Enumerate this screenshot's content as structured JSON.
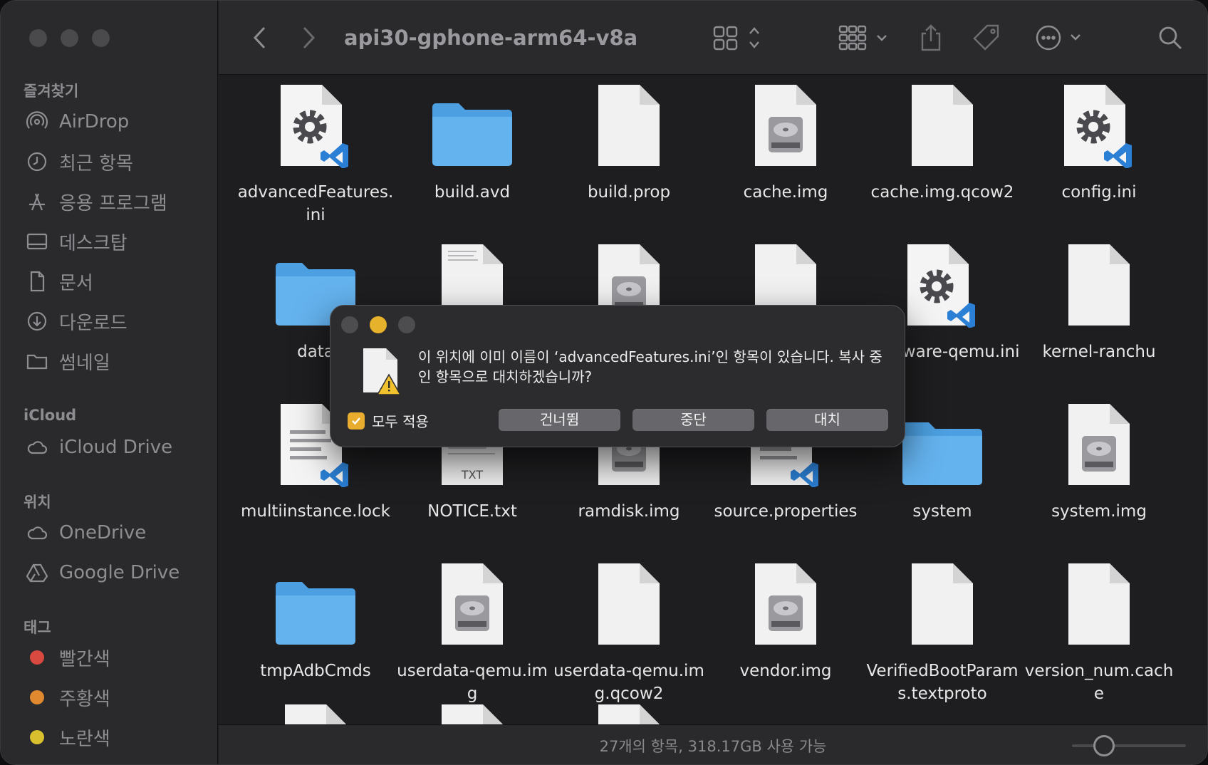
{
  "window": {
    "title": "api30-gphone-arm64-v8a"
  },
  "sidebar": {
    "favorites_header": "즐겨찾기",
    "favorites": [
      {
        "label": "AirDrop",
        "icon": "airdrop-icon"
      },
      {
        "label": "최근 항목",
        "icon": "clock-icon"
      },
      {
        "label": "응용 프로그램",
        "icon": "applications-icon"
      },
      {
        "label": "데스크탑",
        "icon": "desktop-icon"
      },
      {
        "label": "문서",
        "icon": "document-icon"
      },
      {
        "label": "다운로드",
        "icon": "download-icon"
      },
      {
        "label": "썸네일",
        "icon": "folder-icon"
      }
    ],
    "icloud_header": "iCloud",
    "icloud": [
      {
        "label": "iCloud Drive",
        "icon": "cloud-icon"
      }
    ],
    "locations_header": "위치",
    "locations": [
      {
        "label": "OneDrive",
        "icon": "cloud-icon"
      },
      {
        "label": "Google Drive",
        "icon": "drive-icon"
      }
    ],
    "tags_header": "태그",
    "tags": [
      {
        "label": "빨간색",
        "color": "#d84a3f"
      },
      {
        "label": "주황색",
        "color": "#e0892f"
      },
      {
        "label": "노란색",
        "color": "#d8c02f"
      }
    ]
  },
  "files": [
    {
      "name": "advancedFeatures.ini",
      "type": "settings-vscode"
    },
    {
      "name": "build.avd",
      "type": "folder"
    },
    {
      "name": "build.prop",
      "type": "blank"
    },
    {
      "name": "cache.img",
      "type": "disk"
    },
    {
      "name": "cache.img.qcow2",
      "type": "blank"
    },
    {
      "name": "config.ini",
      "type": "settings-vscode"
    },
    {
      "name": "data",
      "type": "folder"
    },
    {
      "name": "",
      "type": "text"
    },
    {
      "name": "",
      "type": "disk"
    },
    {
      "name": "",
      "type": "blank"
    },
    {
      "name": "hardware-qemu.ini",
      "type": "settings-vscode"
    },
    {
      "name": "kernel-ranchu",
      "type": "blank"
    },
    {
      "name": "multiinstance.lock",
      "type": "lines-vscode"
    },
    {
      "name": "NOTICE.txt",
      "type": "txt"
    },
    {
      "name": "ramdisk.img",
      "type": "disk"
    },
    {
      "name": "source.properties",
      "type": "lines-vscode"
    },
    {
      "name": "system",
      "type": "folder"
    },
    {
      "name": "system.img",
      "type": "disk"
    },
    {
      "name": "tmpAdbCmds",
      "type": "folder"
    },
    {
      "name": "userdata-qemu.img",
      "type": "disk"
    },
    {
      "name": "userdata-qemu.img.qcow2",
      "type": "blank"
    },
    {
      "name": "vendor.img",
      "type": "disk"
    },
    {
      "name": "VerifiedBootParams.textproto",
      "type": "blank"
    },
    {
      "name": "version_num.cache",
      "type": "blank"
    }
  ],
  "status": {
    "text": "27개의 항목, 318.17GB 사용 가능"
  },
  "dialog": {
    "message": "이 위치에 이미 이름이 ‘advancedFeatures.ini’인 항목이 있습니다. 복사 중인 항목으로 대치하겠습니까?",
    "apply_all_label": "모두 적용",
    "apply_all_checked": true,
    "skip_label": "건너뜀",
    "stop_label": "중단",
    "replace_label": "대치"
  }
}
